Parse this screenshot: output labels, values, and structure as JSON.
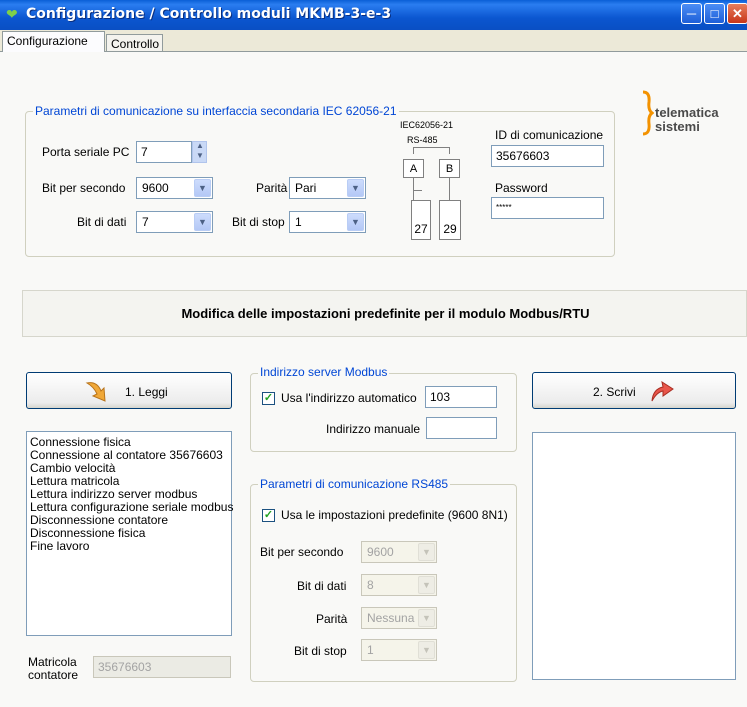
{
  "window": {
    "title": "Configurazione / Controllo moduli MKMB-3-e-3",
    "app_icon": "heart-icon",
    "controls": [
      "minimize-icon",
      "maximize-icon",
      "close-icon"
    ]
  },
  "tabs": [
    {
      "label": "Configurazione",
      "active": true
    },
    {
      "label": "Controllo",
      "active": false
    }
  ],
  "iec_group": {
    "title": "Parametri di comunicazione su interfaccia secondaria IEC 62056-21",
    "porta_label": "Porta seriale PC",
    "porta_value": "7",
    "bps_label": "Bit per secondo",
    "bps_value": "9600",
    "parita_label": "Parità",
    "parita_value": "Pari",
    "databits_label": "Bit di dati",
    "databits_value": "7",
    "stopbits_label": "Bit di stop",
    "stopbits_value": "1",
    "id_label": "ID di comunicazione",
    "id_value": "35676603",
    "password_label": "Password",
    "password_value": "*****"
  },
  "diagram": {
    "title_line1": "IEC62056-21",
    "title_line2": "RS-485",
    "box_a": "A",
    "box_b": "B",
    "term_1": "27",
    "term_2": "29"
  },
  "logo": {
    "line1": "telematica",
    "line2": "sistemi",
    "color": "#f39200"
  },
  "banner": {
    "text": "Modifica delle impostazioni predefinite per il modulo Modbus/RTU"
  },
  "buttons": {
    "read_label": "1. Leggi",
    "write_label": "2. Scrivi",
    "read_icon": "arrow-down-right-icon",
    "write_icon": "arrow-up-right-icon"
  },
  "log": {
    "items": [
      "Connessione fisica",
      "Connessione al contatore 35676603",
      "Cambio velocità",
      "Lettura matricola",
      "Lettura indirizzo server modbus",
      "Lettura configurazione seriale modbus",
      "Disconnessione contatore",
      "Disconnessione fisica",
      "Fine lavoro"
    ]
  },
  "matricola": {
    "label_line1": "Matricola",
    "label_line2": "contatore",
    "value": "35676603"
  },
  "modbus_group": {
    "title": "Indirizzo server Modbus",
    "auto_label": "Usa l'indirizzo automatico",
    "auto_checked": true,
    "auto_value": "103",
    "manual_label": "Indirizzo manuale",
    "manual_value": ""
  },
  "rs485_group": {
    "title": "Parametri di comunicazione RS485",
    "default_label": "Usa le impostazioni predefinite (9600 8N1)",
    "default_checked": true,
    "bps_label": "Bit per secondo",
    "bps_value": "9600",
    "databits_label": "Bit di dati",
    "databits_value": "8",
    "parita_label": "Parità",
    "parita_value": "Nessuna",
    "stopbits_label": "Bit di stop",
    "stopbits_value": "1"
  }
}
